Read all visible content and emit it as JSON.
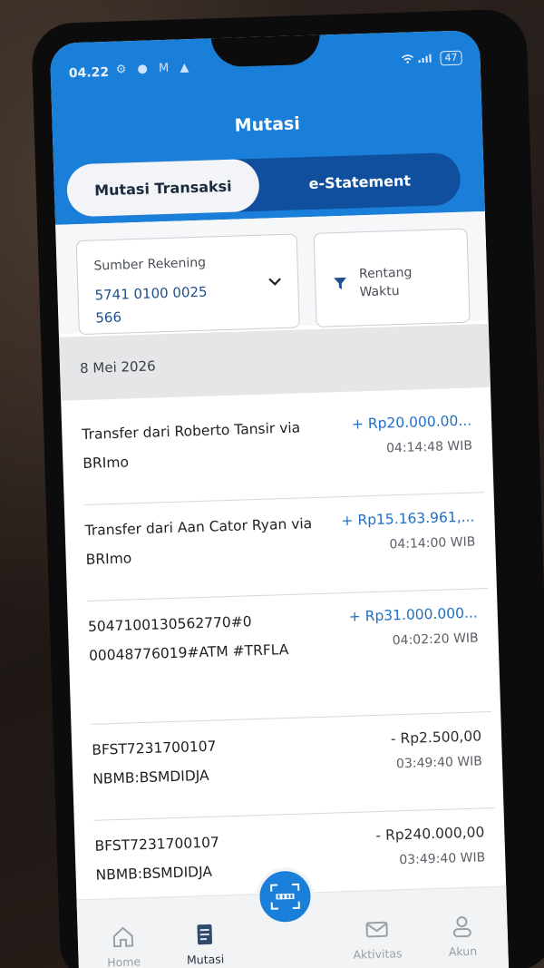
{
  "status_bar": {
    "time": "04.22",
    "battery": "47"
  },
  "header": {
    "title": "Mutasi"
  },
  "tabs": [
    {
      "label": "Mutasi Transaksi",
      "active": true
    },
    {
      "label": "e-Statement",
      "active": false
    }
  ],
  "filters": {
    "account": {
      "label": "Sumber Rekening",
      "value": "5741 0100 0025 566"
    },
    "range": {
      "label": "Rentang Waktu"
    }
  },
  "date_header": "8 Mei 2026",
  "transactions": [
    {
      "description": "Transfer dari Roberto Tansir via BRImo",
      "amount": "+ Rp20.000.00...",
      "time": "04:14:48 WIB",
      "type": "credit"
    },
    {
      "description": "Transfer dari Aan Cator Ryan via BRImo",
      "amount": "+ Rp15.163.961,...",
      "time": "04:14:00 WIB",
      "type": "credit"
    },
    {
      "description": "5047100130562770#0 00048776019#ATM #TRFLA",
      "amount": "+ Rp31.000.000...",
      "time": "04:02:20 WIB",
      "type": "credit"
    },
    {
      "description": "BFST7231700107 NBMB:BSMDIDJA",
      "amount": "- Rp2.500,00",
      "time": "03:49:40 WIB",
      "type": "debit"
    },
    {
      "description": "BFST7231700107 NBMB:BSMDIDJA",
      "amount": "- Rp240.000,00",
      "time": "03:49:40 WIB",
      "type": "debit"
    }
  ],
  "bottom_nav": {
    "items": [
      {
        "label": "Home",
        "icon": "home-icon"
      },
      {
        "label": "Mutasi",
        "icon": "receipt-icon",
        "active": true
      },
      {
        "label": "Aktivitas",
        "icon": "mail-icon"
      },
      {
        "label": "Akun",
        "icon": "user-icon"
      }
    ],
    "center_icon": "qris-scan-icon"
  },
  "colors": {
    "header_blue": "#1a7fd8",
    "tab_dark_blue": "#0f4f9e",
    "credit_blue": "#1f6fc6"
  }
}
